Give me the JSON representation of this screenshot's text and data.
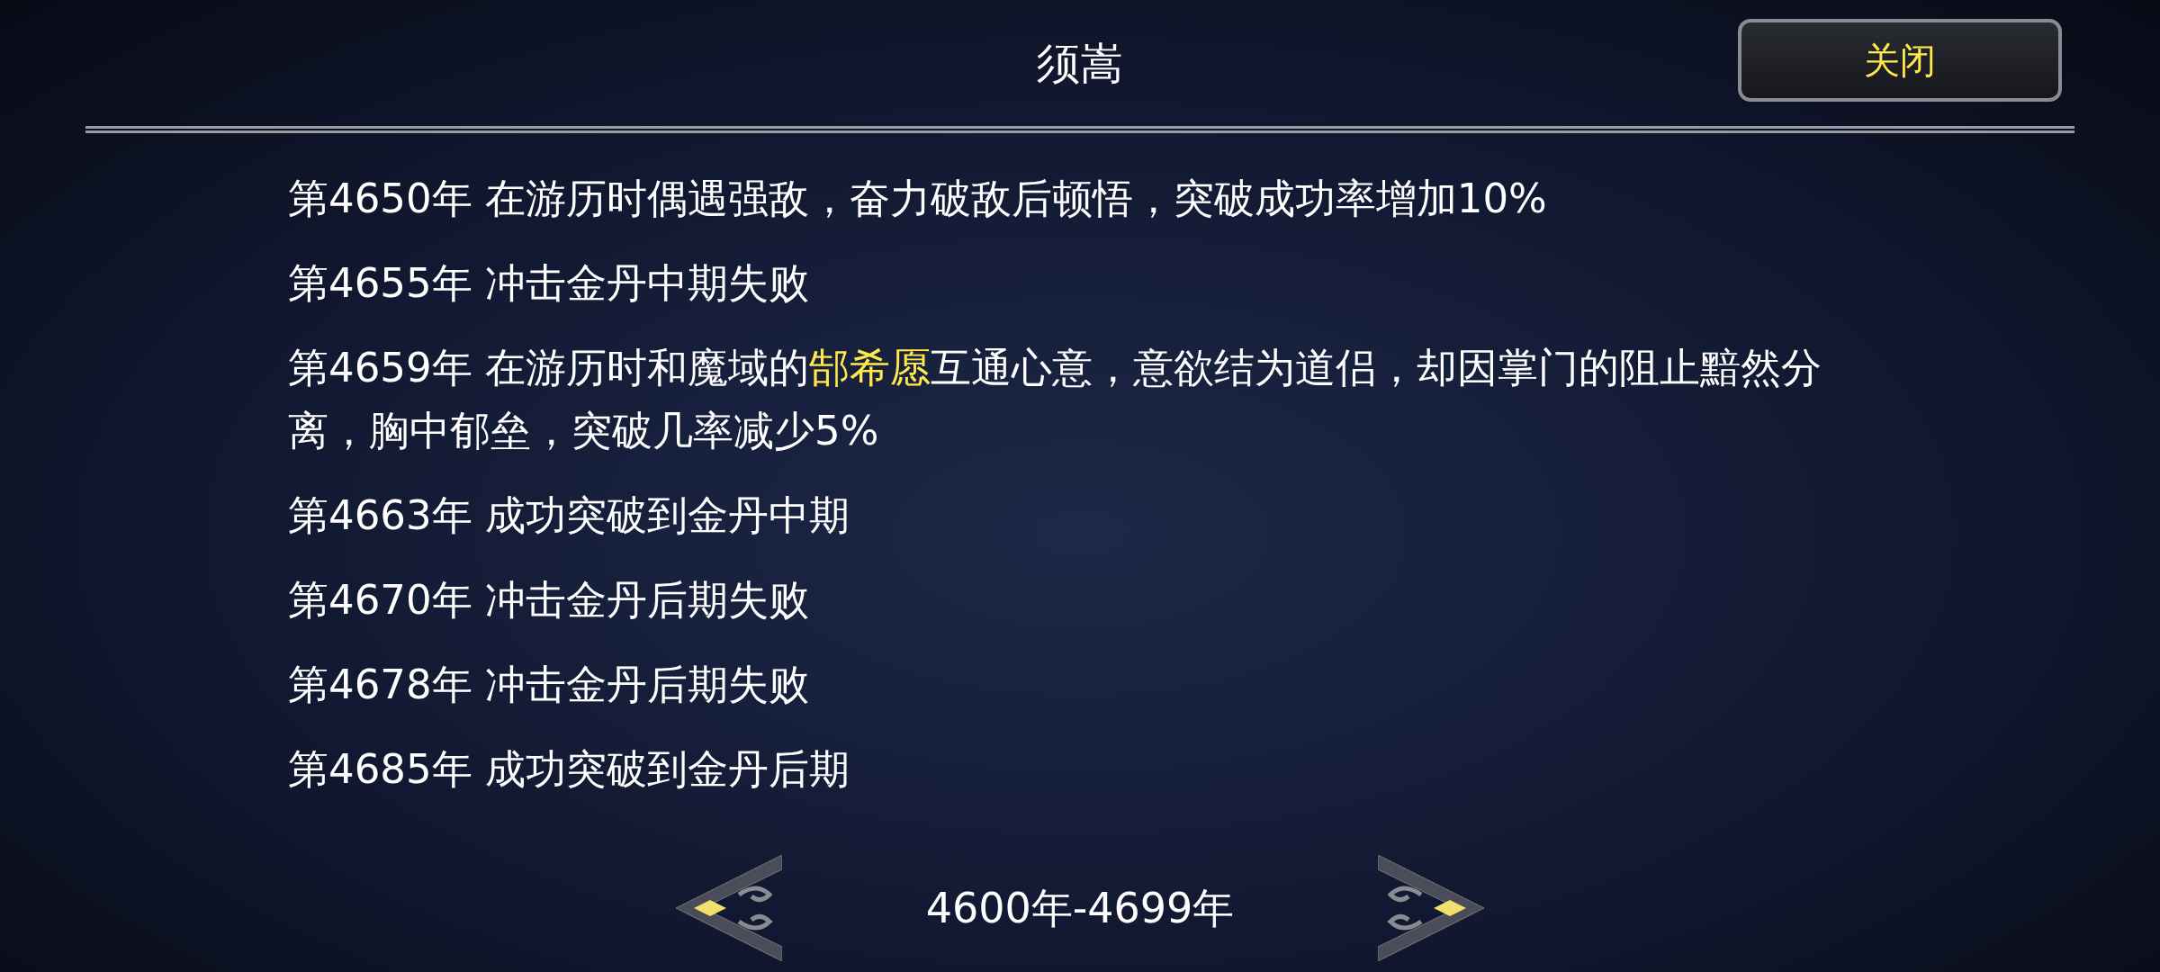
{
  "header": {
    "title": "须嵩",
    "close_button": "关闭"
  },
  "entries": [
    {
      "year": "第4650年",
      "segments": [
        {
          "kind": "plain",
          "text": "在游历时偶遇强敌，奋力破敌后顿悟，突破成功率增加10%"
        }
      ]
    },
    {
      "year": "第4655年",
      "segments": [
        {
          "kind": "plain",
          "text": "冲击金丹中期失败"
        }
      ]
    },
    {
      "year": "第4659年",
      "segments": [
        {
          "kind": "plain",
          "text": "在游历时和魔域的"
        },
        {
          "kind": "name",
          "text": "郜希愿"
        },
        {
          "kind": "plain",
          "text": "互通心意，意欲结为道侣，却因掌门的阻止黯然分离，胸中郁垒，突破几率减少5%"
        }
      ]
    },
    {
      "year": "第4663年",
      "segments": [
        {
          "kind": "plain",
          "text": "成功突破到金丹中期"
        }
      ]
    },
    {
      "year": "第4670年",
      "segments": [
        {
          "kind": "plain",
          "text": "冲击金丹后期失败"
        }
      ]
    },
    {
      "year": "第4678年",
      "segments": [
        {
          "kind": "plain",
          "text": "冲击金丹后期失败"
        }
      ]
    },
    {
      "year": "第4685年",
      "segments": [
        {
          "kind": "plain",
          "text": "成功突破到金丹后期"
        }
      ]
    }
  ],
  "pager": {
    "range": "4600年-4699年"
  }
}
